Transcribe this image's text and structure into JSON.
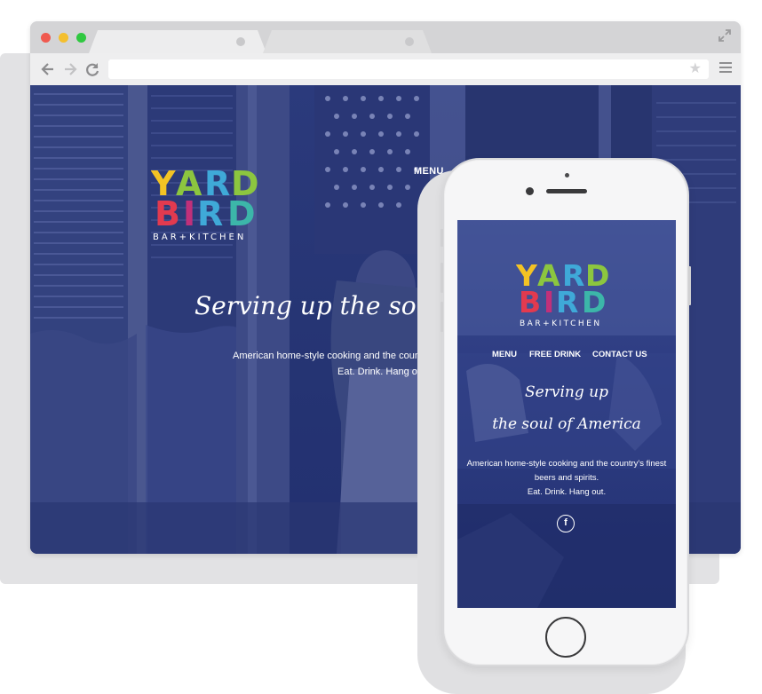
{
  "desktop": {
    "nav_menu": "MENU",
    "tagline": "Serving up the soul of",
    "description": "American home-style cooking and the country's fin",
    "subline": "Eat. Drink. Hang out."
  },
  "logo": {
    "line1": "YARD",
    "line2": "BIRD",
    "line3": "BAR+KITCHEN"
  },
  "mobile": {
    "nav": [
      "MENU",
      "FREE DRINK",
      "CONTACT US"
    ],
    "tagline_line1": "Serving up",
    "tagline_line2": "the soul of America",
    "description_line1": "American home-style cooking and the country's finest",
    "description_line2": "beers and spirits.",
    "subline": "Eat. Drink. Hang out.",
    "social_icon": "f"
  },
  "icons": {
    "back": "back-arrow-icon",
    "forward": "forward-arrow-icon",
    "reload": "reload-icon",
    "star": "star-icon",
    "menu": "hamburger-menu-icon",
    "expand": "expand-icon",
    "social": "facebook-icon"
  },
  "colors": {
    "overlay_blue": "#2b3a7c",
    "logo_yellow": "#f3c324",
    "logo_green": "#8cc63f",
    "logo_blue": "#3fa9d8",
    "logo_red": "#e23a4f",
    "logo_magenta": "#c1307a",
    "logo_teal": "#3cb6a9"
  }
}
